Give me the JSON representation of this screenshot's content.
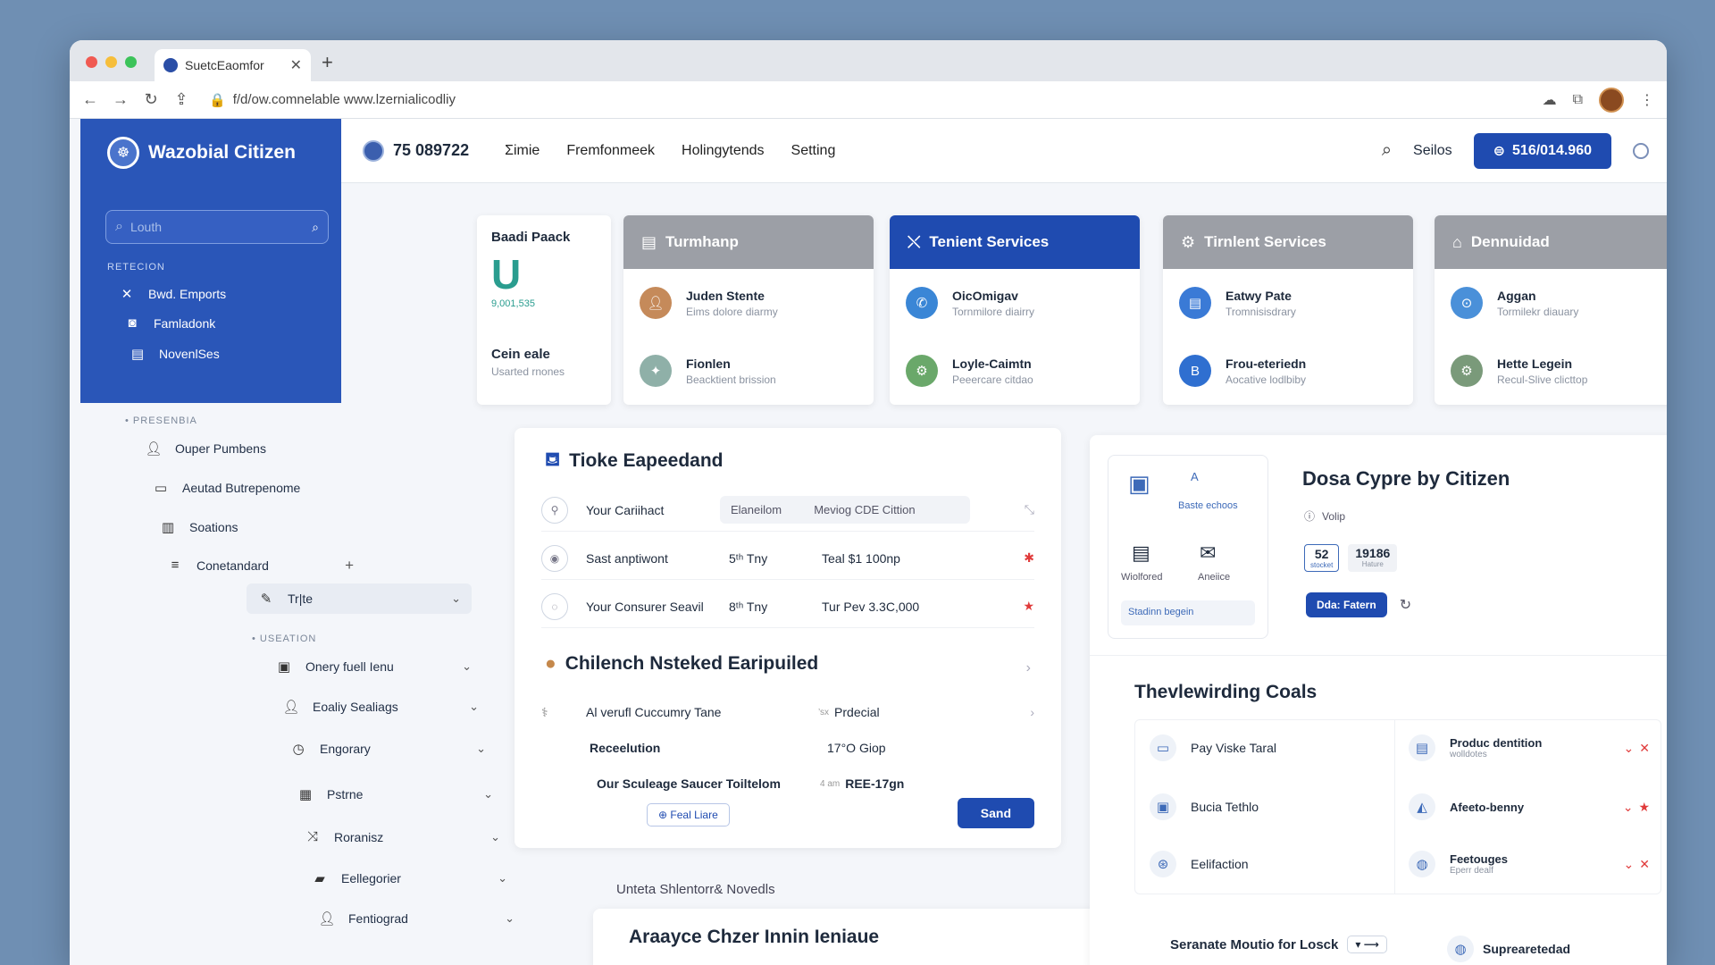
{
  "browser": {
    "tab_title": "SuetcEaomfor",
    "url": "f/d/ow.comnelable www.lzernialicodliy"
  },
  "brand": {
    "name": "Wazobial Citizen"
  },
  "search": {
    "placeholder": "Louth"
  },
  "sidebar": {
    "section1": "RETECION",
    "items1": [
      {
        "label": "Bwd. Emports",
        "icon": "close-icon"
      },
      {
        "label": "Famladonk",
        "icon": "chat-icon"
      },
      {
        "label": "NovenlSes",
        "icon": "document-icon"
      }
    ],
    "section2": "• PRESENBIA",
    "items2": [
      {
        "label": "Ouper Pumbens",
        "icon": "user-icon"
      },
      {
        "label": "Aeutad Butrepenome",
        "icon": "window-icon"
      },
      {
        "label": "Soations",
        "icon": "book-icon"
      },
      {
        "label": "Conetandard",
        "icon": "list-icon"
      },
      {
        "label": "Tr|te",
        "icon": "edit-icon"
      }
    ],
    "section3": "• USEATION",
    "items3": [
      {
        "label": "Onery fuell Ienu",
        "icon": "card-icon"
      },
      {
        "label": "Eoaliy Sealiags",
        "icon": "user-icon"
      },
      {
        "label": "Engorary",
        "icon": "clock-icon"
      },
      {
        "label": "Pstrne",
        "icon": "calendar-icon"
      },
      {
        "label": "Roranisz",
        "icon": "shuffle-icon"
      },
      {
        "label": "Eellegorier",
        "icon": "folder-icon"
      },
      {
        "label": "Fentiograd",
        "icon": "user-icon"
      }
    ]
  },
  "topnav": {
    "org_id": "75 089722",
    "links": [
      "Σimie",
      "Fremfonmeek",
      "Holingytends",
      "Setting"
    ],
    "seilos": "Seilos",
    "cta": "516/014.960"
  },
  "pack": {
    "title": "Baadi Paack",
    "big": "U",
    "number": "9,001,535",
    "caption_title": "Cein eale",
    "caption_sub": "Usarted rnones"
  },
  "services": [
    {
      "title": "Turmhanp",
      "rows": [
        {
          "name": "Juden Stente",
          "sub": "Eims dolore diarmy"
        },
        {
          "name": "Fionlen",
          "sub": "Beacktient brission"
        }
      ]
    },
    {
      "title": "Tenient Services",
      "rows": [
        {
          "name": "OicOmigav",
          "sub": "Tornmilore diairry"
        },
        {
          "name": "Loyle-Caimtn",
          "sub": "Peeercare citdao"
        }
      ]
    },
    {
      "title": "Tirnlent Services",
      "rows": [
        {
          "name": "Eatwy Pate",
          "sub": "Tromnisisdrary"
        },
        {
          "name": "Frou-eteriedn",
          "sub": "Aocative lodlbiby"
        }
      ]
    },
    {
      "title": "Dennuidad",
      "rows": [
        {
          "name": "Aggan",
          "sub": "Tormilekr diauary"
        },
        {
          "name": "Hette Legein",
          "sub": "Recul-Slive clicttop"
        }
      ]
    }
  ],
  "main": {
    "title": "Tioke Eapeedand",
    "row1": {
      "label": "Your Cariihact",
      "f1": "Elaneilom",
      "f2": "Meviog CDE Cittion"
    },
    "row2": {
      "label": "Sast anptiwont",
      "mid": "5ᵗʰ Tny",
      "val": "Teal $1 100np"
    },
    "row3": {
      "label": "Your Consurer Seavil",
      "mid": "8ᵗʰ Tny",
      "val": "Tur Pev 3.3C,000"
    },
    "sub_title": "Chilench Nsteked Earipuiled",
    "sub_row1": {
      "label": "Al verufl Cuccumry Tane",
      "tag": "Prdecial",
      "small": "’sx"
    },
    "sub_row2": {
      "label": "Receelution",
      "val": "17°O Giop"
    },
    "sub_row3": {
      "label": "Our Sculeage Saucer Toiltelom",
      "small": "4 am",
      "val": "REE-17gn"
    },
    "feal_btn": "Feal Liare",
    "send_btn": "Sand",
    "footer_link": "Unteta Shlentorr& Novedls",
    "lower_title": "Araayce Chzer Innin Ieniaue"
  },
  "dosa": {
    "title": "Dosa Cypre by Citizen",
    "a_label": "A",
    "basic": "Baste echoos",
    "icon1": "Wiolfored",
    "icon2": "Aneiice",
    "input": "Stadinn begein",
    "volip": "Volip",
    "stat1": "52",
    "stat1_sub": "stocket",
    "stat2": "19186",
    "stat2_sub": "Hature",
    "action": "Dda: Fatern"
  },
  "goals": {
    "title": "Thevlewirding Coals",
    "left": [
      "Pay Viske Taral",
      "Bucia Tethlo",
      "Eelifaction"
    ],
    "right": [
      {
        "name": "Produc dentition",
        "sub": "wolldotes"
      },
      {
        "name": "Afeeto-benny",
        "sub": ""
      },
      {
        "name": "Feetouges",
        "sub": "Eperr dealf"
      }
    ],
    "footer_left": "Seranate Moutio for Losck",
    "footer_right": "Suprearetedad"
  }
}
